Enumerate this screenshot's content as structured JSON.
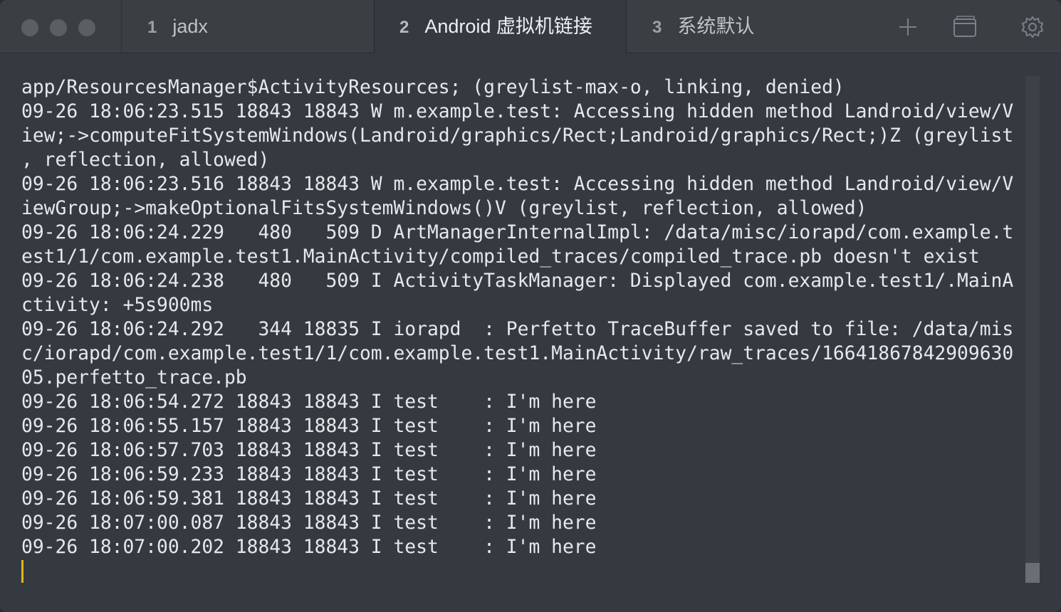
{
  "tabs": [
    {
      "number": "1",
      "label": "jadx"
    },
    {
      "number": "2",
      "label": "Android 虚拟机链接"
    },
    {
      "number": "3",
      "label": "系统默认"
    }
  ],
  "toolbar": {
    "new_tab_icon": "plus-icon",
    "window_icon": "window-icon",
    "settings_icon": "gear-icon"
  },
  "colors": {
    "background": "#353a41",
    "titlebar": "#3b3f44",
    "text": "#e6e8ea",
    "cursor": "#e2b714"
  },
  "terminal": {
    "lines": [
      "app/ResourcesManager$ActivityResources; (greylist-max-o, linking, denied)",
      "09-26 18:06:23.515 18843 18843 W m.example.test: Accessing hidden method Landroid/view/V",
      "iew;->computeFitSystemWindows(Landroid/graphics/Rect;Landroid/graphics/Rect;)Z (greylist",
      ", reflection, allowed)",
      "09-26 18:06:23.516 18843 18843 W m.example.test: Accessing hidden method Landroid/view/V",
      "iewGroup;->makeOptionalFitsSystemWindows()V (greylist, reflection, allowed)",
      "09-26 18:06:24.229   480   509 D ArtManagerInternalImpl: /data/misc/iorapd/com.example.t",
      "est1/1/com.example.test1.MainActivity/compiled_traces/compiled_trace.pb doesn't exist",
      "09-26 18:06:24.238   480   509 I ActivityTaskManager: Displayed com.example.test1/.MainA",
      "ctivity: +5s900ms",
      "09-26 18:06:24.292   344 18835 I iorapd  : Perfetto TraceBuffer saved to file: /data/mis",
      "c/iorapd/com.example.test1/1/com.example.test1.MainActivity/raw_traces/16641867842909630",
      "05.perfetto_trace.pb",
      "09-26 18:06:54.272 18843 18843 I test    : I'm here",
      "09-26 18:06:55.157 18843 18843 I test    : I'm here",
      "09-26 18:06:57.703 18843 18843 I test    : I'm here",
      "09-26 18:06:59.233 18843 18843 I test    : I'm here",
      "09-26 18:06:59.381 18843 18843 I test    : I'm here",
      "09-26 18:07:00.087 18843 18843 I test    : I'm here",
      "09-26 18:07:00.202 18843 18843 I test    : I'm here"
    ]
  }
}
